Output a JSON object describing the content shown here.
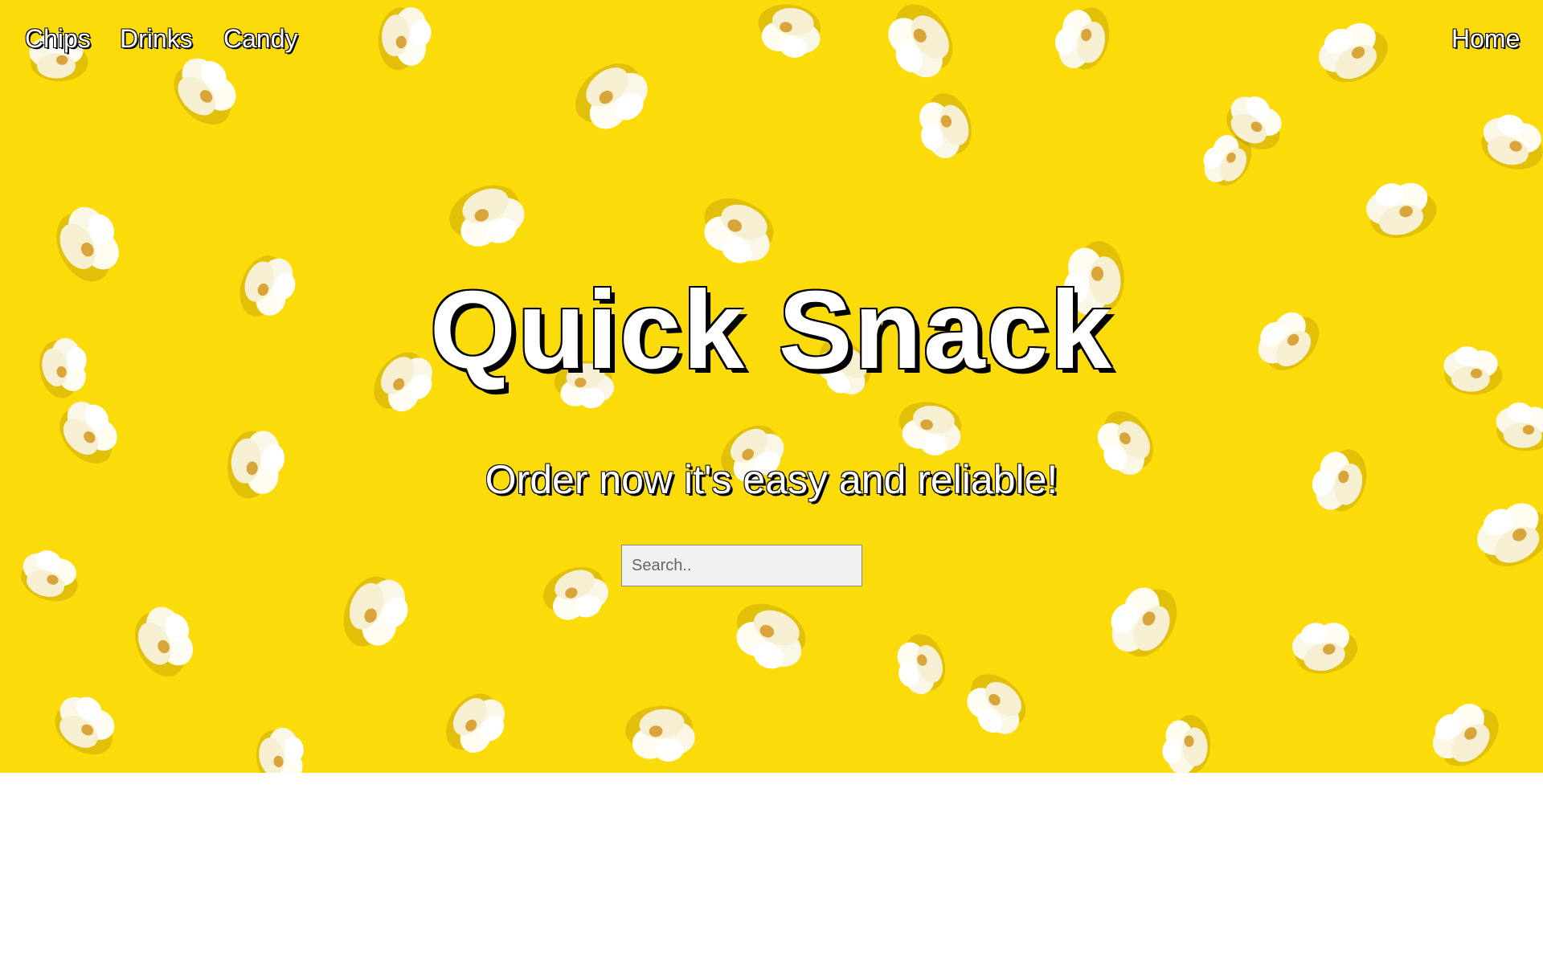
{
  "nav": {
    "left_links": [
      {
        "label": "Chips"
      },
      {
        "label": "Drinks"
      },
      {
        "label": "Candy"
      }
    ],
    "right_link": {
      "label": "Home"
    }
  },
  "hero": {
    "title": "Quick Snack",
    "subtitle": "Order now it's easy and reliable!",
    "background_color": "#fbdb0a",
    "background_image": "popcorn-pattern"
  },
  "search": {
    "placeholder": "Search..",
    "value": ""
  }
}
